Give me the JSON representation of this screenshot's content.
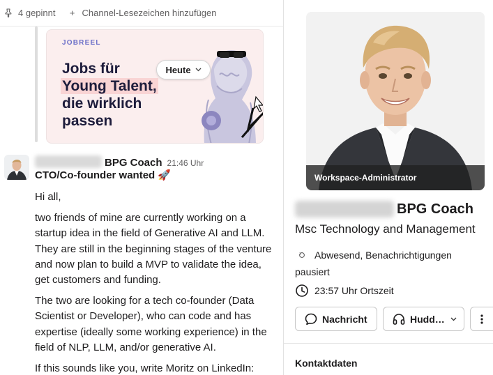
{
  "bookmarks": {
    "pinned_label": "4 gepinnt",
    "add_label": "Channel-Lesezeichen hinzufügen"
  },
  "ad": {
    "brand": "JOBREEL",
    "headline_lines": [
      "Jobs für",
      "Young Talent,",
      "die wirklich",
      "passen"
    ],
    "date_pill": "Heute"
  },
  "message": {
    "sender_role": "BPG Coach",
    "time": "21:46 Uhr",
    "title": "CTO/Co-founder wanted 🚀",
    "paragraphs": [
      "Hi all,",
      "two friends of mine are currently working on a startup idea in the field of Generative AI and LLM. They are still in the beginning stages of the venture and now plan to build a MVP to validate the idea, get customers and funding.",
      "The two are looking for a tech co-founder (Data Scientist or Developer), who can code and has expertise (ideally some working experience) in the field of NLP, LLM, and/or generative AI.",
      "If this sounds like you, write Moritz on LinkedIn:"
    ]
  },
  "profile": {
    "badge": "Workspace-Administrator",
    "name_suffix": "BPG Coach",
    "title": "Msc Technology and Management",
    "status": "Abwesend, Benachrichtigungen pausiert",
    "local_time": "23:57 Uhr Ortszeit",
    "buttons": {
      "message": "Nachricht",
      "huddle": "Hudd…"
    },
    "contact_heading": "Kontaktdaten"
  },
  "colors": {
    "ad_background": "#fbeeee",
    "ad_brand": "#6b6fc8",
    "badge_background": "#202020"
  }
}
